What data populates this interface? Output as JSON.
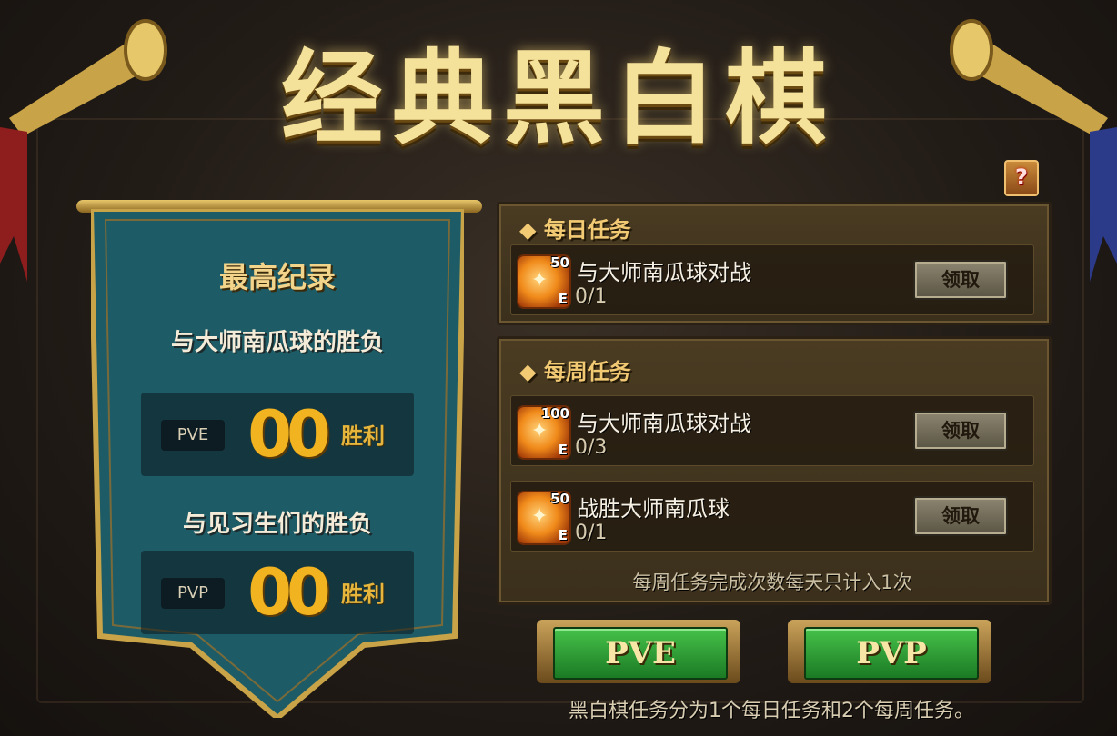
{
  "title": "经典黑白棋",
  "help_icon": "?",
  "record": {
    "heading": "最高纪录",
    "vs_master_label": "与大师南瓜球的胜负",
    "vs_apprentice_label": "与见习生们的胜负",
    "pve": {
      "mode": "PVE",
      "value": "00",
      "suffix": "胜利"
    },
    "pvp": {
      "mode": "PVP",
      "value": "00",
      "suffix": "胜利"
    }
  },
  "daily": {
    "heading": "◆ 每日任务",
    "quests": [
      {
        "reward": "50",
        "name": "与大师南瓜球对战",
        "progress": "0/1",
        "button": "领取"
      }
    ]
  },
  "weekly": {
    "heading": "◆ 每周任务",
    "quests": [
      {
        "reward": "100",
        "name": "与大师南瓜球对战",
        "progress": "0/3",
        "button": "领取"
      },
      {
        "reward": "50",
        "name": "战胜大师南瓜球",
        "progress": "0/1",
        "button": "领取"
      }
    ],
    "note": "每周任务完成次数每天只计入1次"
  },
  "buttons": {
    "pve": "PVE",
    "pvp": "PVP"
  },
  "footer_note": "黑白棋任务分为1个每日任务和2个每周任务。",
  "medal_letter": "E",
  "colors": {
    "banner": "#1c5f6a",
    "gold": "#f1b31f",
    "button_green": "#2f9c35"
  }
}
